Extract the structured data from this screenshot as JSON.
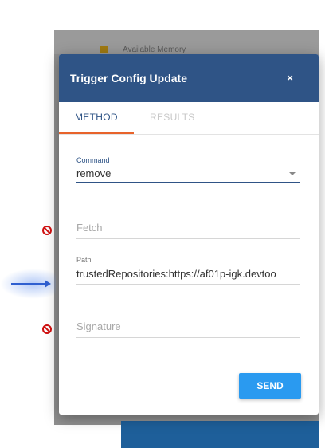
{
  "background": {
    "behind_label": "Available Memory"
  },
  "dialog": {
    "title": "Trigger Config Update",
    "close_glyph": "×",
    "tabs": [
      {
        "label": "METHOD",
        "active": true
      },
      {
        "label": "RESULTS",
        "active": false
      }
    ],
    "command": {
      "label": "Command",
      "value": "remove"
    },
    "fetch": {
      "placeholder": "Fetch",
      "value": "",
      "disabled_marker": true
    },
    "path": {
      "label": "Path",
      "value": "trustedRepositories:https://af01p-igk.devtoo"
    },
    "signature": {
      "placeholder": "Signature",
      "value": "",
      "disabled_marker": true
    },
    "send_label": "SEND"
  },
  "colors": {
    "header": "#2f5486",
    "active_tab_underline": "#e8632b",
    "send_button": "#2a9af0",
    "disabled_marker": "#d01010",
    "pointer_arrow": "#2f5fd0"
  },
  "icons": [
    "close-icon",
    "dropdown-caret-icon",
    "no-entry-icon",
    "pointer-arrow-icon"
  ]
}
